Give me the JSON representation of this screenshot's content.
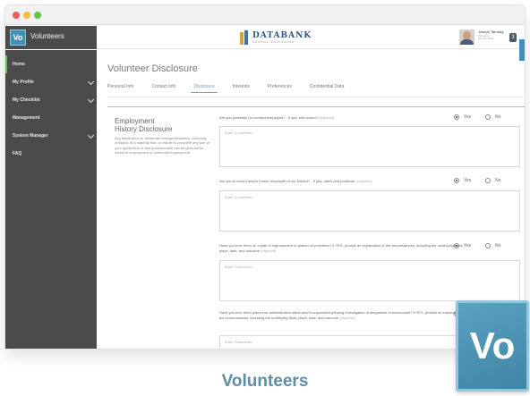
{
  "window": {
    "traffic_lights": [
      "close",
      "minimize",
      "maximize"
    ]
  },
  "app": {
    "logo_text": "Vo",
    "name": "Volunteers",
    "brand_logo_name": "DATABANK",
    "brand_logo_sub": "SCHOOL SOLUTIONS",
    "user": {
      "name": "Joseph Tarnisky",
      "role": "Principal",
      "date": "Apr 08, 2018"
    },
    "notification_count": "3"
  },
  "sidebar": {
    "items": [
      {
        "label": "Home",
        "active": true,
        "has_children": false
      },
      {
        "label": "My Profile",
        "active": false,
        "has_children": true
      },
      {
        "label": "My Checklist",
        "active": false,
        "has_children": true
      },
      {
        "label": "Management",
        "active": false,
        "has_children": false
      },
      {
        "label": "System Manager",
        "active": false,
        "has_children": true
      },
      {
        "label": "FAQ",
        "active": false,
        "has_children": false
      }
    ]
  },
  "main": {
    "title": "Volunteer Disclosure",
    "tabs": [
      {
        "label": "Personal Info",
        "active": false
      },
      {
        "label": "Contact Info",
        "active": false
      },
      {
        "label": "Disclosure",
        "active": true
      },
      {
        "label": "Interests",
        "active": false
      },
      {
        "label": "Preferences",
        "active": false
      },
      {
        "label": "Confidential Data",
        "active": false
      }
    ],
    "section": {
      "title_line1": "Employment",
      "title_line2": "History Disclosure",
      "description": "Any falsification or deliberate misrepresentation, including omission of a material fact, or failure to complete any part of your application or this questionnaire can be grounds for denial of employment or continued employment."
    },
    "questions": [
      {
        "text": "Are you presently (or contract)employed? - If yes, with whom?",
        "required_label": "(required)",
        "yes_label": "Yes",
        "no_label": "No",
        "selected": "yes",
        "comment_placeholder": "Enter Comments"
      },
      {
        "text": "Are you a current and/or former employee of our District? - If yes, dates and positions.",
        "required_label": "(required)",
        "yes_label": "Yes",
        "no_label": "No",
        "selected": "yes",
        "comment_placeholder": "Enter Comments"
      },
      {
        "text": "Have you ever been on a plan of improvement or placed on probation? If YES, provide an explanation of the circumstances, including the underlying facts, place, date, and outcome",
        "required_label": "(required)",
        "yes_label": "Yes",
        "no_label": "No",
        "selected": "yes",
        "comment_placeholder": "Enter Comments"
      },
      {
        "text": "Have you ever been placed on administrative leave and/or suspended pending investigation of allegations of misconduct? If YES, provide an explanation of the circumstances, including the underlying facts, place, date, and outcome",
        "required_label": "(required)",
        "selected": "yes",
        "comment_placeholder": "Enter Comments"
      }
    ]
  },
  "footer": {
    "caption": "Volunteers",
    "big_logo_text": "Vo"
  },
  "colors": {
    "accent": "#6fa3c1",
    "sidebar_bg": "#4b4b4b",
    "active_indicator": "#67c24f",
    "caption": "#5e8ea6",
    "logo_tile": "#3f92b7"
  }
}
